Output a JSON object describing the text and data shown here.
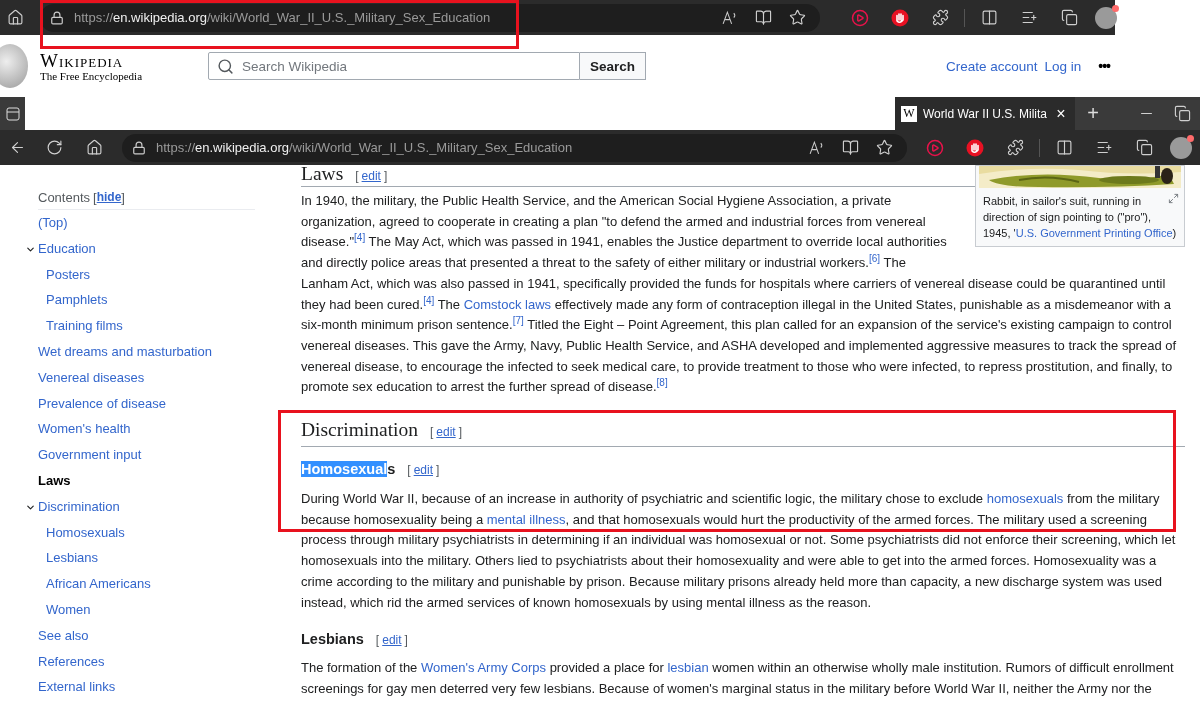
{
  "back_window": {
    "url": {
      "scheme": "https://",
      "host": "en.wikipedia.org",
      "path": "/wiki/World_War_II_U.S._Military_Sex_Education"
    }
  },
  "wiki_header": {
    "logo": "Wikipedia",
    "tagline": "The Free Encyclopedia",
    "search": {
      "placeholder": "Search Wikipedia",
      "button": "Search"
    },
    "links": [
      "Create account",
      "Log in"
    ],
    "more": "•••"
  },
  "front_window": {
    "tab": {
      "favicon": "W",
      "title": "World War II U.S. Milita",
      "close": "×"
    },
    "new_tab": "+",
    "url": {
      "scheme": "https://",
      "host": "en.wikipedia.org",
      "path": "/wiki/World_War_II_U.S._Military_Sex_Education"
    }
  },
  "toc": {
    "title": "Contents",
    "toggle": {
      "open": "[",
      "label": "hide",
      "close": "]"
    },
    "items": [
      {
        "label": "(Top)",
        "selected": false
      },
      {
        "label": "Education",
        "selected": false,
        "expanded": true,
        "children": [
          {
            "label": "Posters",
            "selected": false
          },
          {
            "label": "Pamphlets",
            "selected": false
          },
          {
            "label": "Training films",
            "selected": false
          }
        ]
      },
      {
        "label": "Wet dreams and masturbation",
        "selected": false
      },
      {
        "label": "Venereal diseases",
        "selected": false
      },
      {
        "label": "Prevalence of disease",
        "selected": false
      },
      {
        "label": "Women's health",
        "selected": false
      },
      {
        "label": "Government input",
        "selected": false
      },
      {
        "label": "Laws",
        "selected": true
      },
      {
        "label": "Discrimination",
        "selected": false,
        "expanded": true,
        "children": [
          {
            "label": "Homosexuals",
            "selected": false
          },
          {
            "label": "Lesbians",
            "selected": false
          },
          {
            "label": "African Americans",
            "selected": false
          },
          {
            "label": "Women",
            "selected": false
          }
        ]
      },
      {
        "label": "See also",
        "selected": false
      },
      {
        "label": "References",
        "selected": false
      },
      {
        "label": "External links",
        "selected": false
      }
    ]
  },
  "figure": {
    "kind": "picture",
    "caption": [
      {
        "kind": "text",
        "text": "Rabbit, in sailor's suit, running in direction of sign pointing to (\"pro\"), 1945, '"
      },
      {
        "kind": "link",
        "text": "U.S. Government Printing Office"
      },
      {
        "kind": "text",
        "text": ")"
      }
    ]
  },
  "article": [
    {
      "kind": "h2",
      "title": "Laws",
      "edit": {
        "open": "[",
        "label": "edit",
        "close": "]"
      }
    },
    {
      "kind": "p_beside_figure",
      "segments": [
        {
          "kind": "text",
          "text": "In 1940, the military, the Public Health Service, and the American Social Hygiene Association, a private organization, agreed to cooperate in creating a plan \"to defend the armed and industrial forces from venereal disease.\""
        },
        {
          "kind": "ref",
          "text": "[4]"
        },
        {
          "kind": "text",
          "text": " The May Act, which was passed in 1941, enables the Justice department to override local authorities and directly police areas that presented a threat to the safety of either military or industrial workers."
        },
        {
          "kind": "ref",
          "text": "[6]"
        },
        {
          "kind": "text",
          "text": " The"
        }
      ]
    },
    {
      "kind": "p_continued",
      "segments": [
        {
          "kind": "text",
          "text": "Lanham Act, which was also passed in 1941, specifically provided the funds for hospitals where carriers of venereal disease could be quarantined until they had been cured."
        },
        {
          "kind": "ref",
          "text": "[4]"
        },
        {
          "kind": "text",
          "text": " The "
        },
        {
          "kind": "link",
          "text": "Comstock laws"
        },
        {
          "kind": "text",
          "text": " effectively made any form of contraception illegal in the United States, punishable as a misdemeanor with a six-month minimum prison sentence."
        },
        {
          "kind": "ref",
          "text": "[7]"
        },
        {
          "kind": "text",
          "text": " Titled the Eight – Point Agreement, this plan called for an expansion of the service's existing campaign to control venereal diseases. This gave the Army, Navy, Public Health Service, and ASHA developed and implemented aggressive measures to track the spread of venereal disease, to encourage the infected to seek medical care, to provide treatment to those who were infected, to repress prostitution, and finally, to promote sex education to arrest the further spread of disease."
        },
        {
          "kind": "ref",
          "text": "[8]"
        }
      ]
    },
    {
      "kind": "h2",
      "title": "Discrimination",
      "edit": {
        "open": "[",
        "label": "edit",
        "close": "]"
      }
    },
    {
      "kind": "h3",
      "highlighted": "Homosexual",
      "title": "s",
      "edit": {
        "open": "[",
        "label": "edit",
        "close": "]"
      }
    },
    {
      "kind": "p",
      "segments": [
        {
          "kind": "text",
          "text": "During World War II, because of an increase in authority of psychiatric and scientific logic, the military chose to exclude "
        },
        {
          "kind": "link",
          "text": "homosexuals"
        },
        {
          "kind": "text",
          "text": " from the military because homosexuality being a "
        },
        {
          "kind": "link",
          "text": "mental illness"
        },
        {
          "kind": "text",
          "text": ", and that homosexuals would hurt the productivity of the armed forces. The military used a screening process through military psychiatrists in determining if an individual was homosexual or not. Some psychiatrists did not enforce their screening, which let homosexuals into the military. Others lied to psychiatrists about their homosexuality and were able to get into the armed forces. Homosexuality was a crime according to the military and punishable by prison. Because military prisons already held more than capacity, a new discharge system was used instead, which rid the armed services of known homosexuals by using mental illness as the reason."
        }
      ]
    },
    {
      "kind": "h3",
      "title": "Lesbians",
      "edit": {
        "open": "[",
        "label": "edit",
        "close": "]"
      }
    },
    {
      "kind": "p",
      "segments": [
        {
          "kind": "text",
          "text": "The formation of the "
        },
        {
          "kind": "link",
          "text": "Women's Army Corps"
        },
        {
          "kind": "text",
          "text": " provided a place for "
        },
        {
          "kind": "link",
          "text": "lesbian"
        },
        {
          "kind": "text",
          "text": " women within an otherwise wholly male institution. Rumors of difficult enrollment screenings for gay men deterred very few lesbians. Because of women's marginal status in the military before World War II, neither the Army nor the"
        }
      ]
    }
  ]
}
